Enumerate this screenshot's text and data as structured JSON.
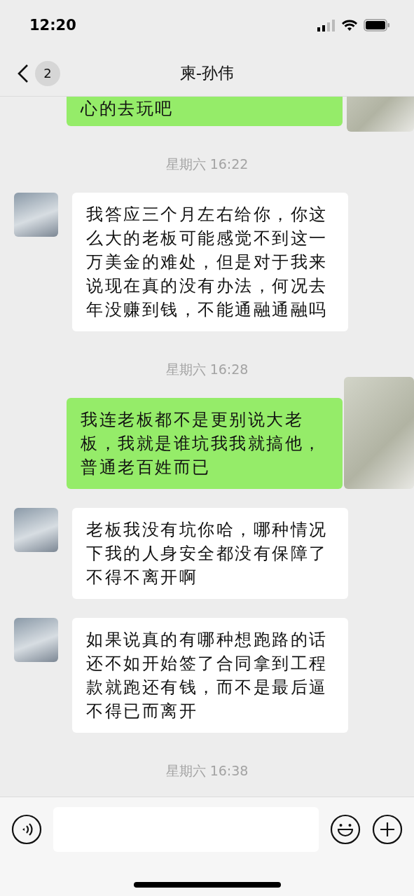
{
  "status_bar": {
    "time": "12:20"
  },
  "nav": {
    "back_count": "2",
    "title": "柬-孙伟"
  },
  "messages": [
    {
      "kind": "message",
      "outgoing": true,
      "text": "心的去玩吧",
      "cut_top": true
    },
    {
      "kind": "time",
      "text": "星期六 16:22"
    },
    {
      "kind": "message",
      "outgoing": false,
      "text": "我答应三个月左右给你，你这么大的老板可能感觉不到这一万美金的难处，但是对于我来说现在真的没有办法，何况去年没赚到钱，不能通融通融吗"
    },
    {
      "kind": "time",
      "text": "星期六 16:28"
    },
    {
      "kind": "message",
      "outgoing": true,
      "text": "我连老板都不是更别说大老板，我就是谁坑我我就搞他，普通老百姓而已"
    },
    {
      "kind": "message",
      "outgoing": false,
      "text": "老板我没有坑你哈，哪种情况下我的人身安全都没有保障了不得不离开啊"
    },
    {
      "kind": "message",
      "outgoing": false,
      "text": "如果说真的有哪种想跑路的话还不如开始签了合同拿到工程款就跑还有钱，而不是最后逼不得已而离开"
    },
    {
      "kind": "time",
      "text": "星期六 16:38"
    }
  ]
}
